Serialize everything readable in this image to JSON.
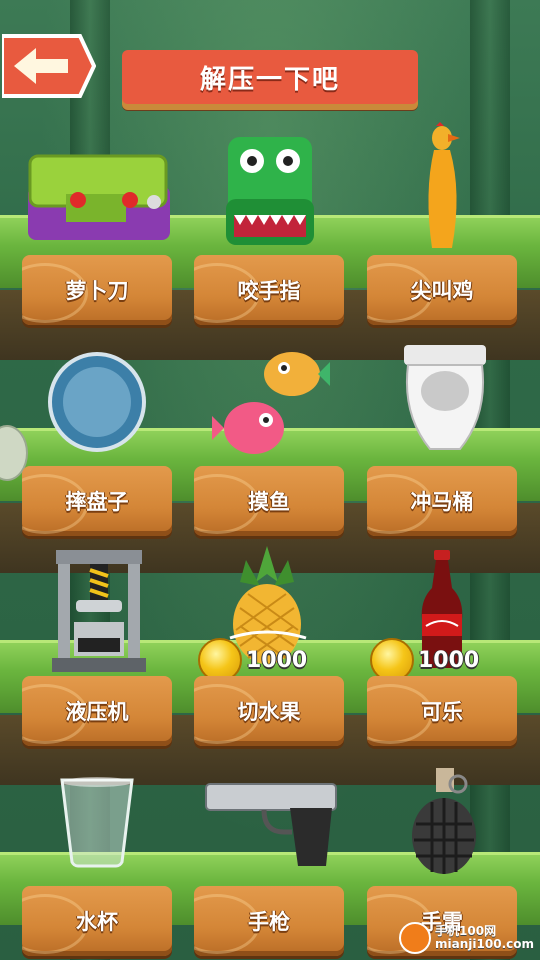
{
  "header": {
    "title": "解压一下吧"
  },
  "items": [
    {
      "label": "萝卜刀"
    },
    {
      "label": "咬手指"
    },
    {
      "label": "尖叫鸡"
    },
    {
      "label": "摔盘子"
    },
    {
      "label": "摸鱼"
    },
    {
      "label": "冲马桶"
    },
    {
      "label": "液压机"
    },
    {
      "label": "切水果",
      "price": "1000"
    },
    {
      "label": "可乐",
      "price": "1000"
    },
    {
      "label": "水杯"
    },
    {
      "label": "手枪"
    },
    {
      "label": "手雷"
    }
  ],
  "watermark": {
    "name": "手机100网",
    "url": "mianji100.com"
  },
  "colors": {
    "title_bg": "#e85a3f",
    "plank": "#d48637",
    "grass": "#6ab53e",
    "coin": "#f5c518"
  }
}
